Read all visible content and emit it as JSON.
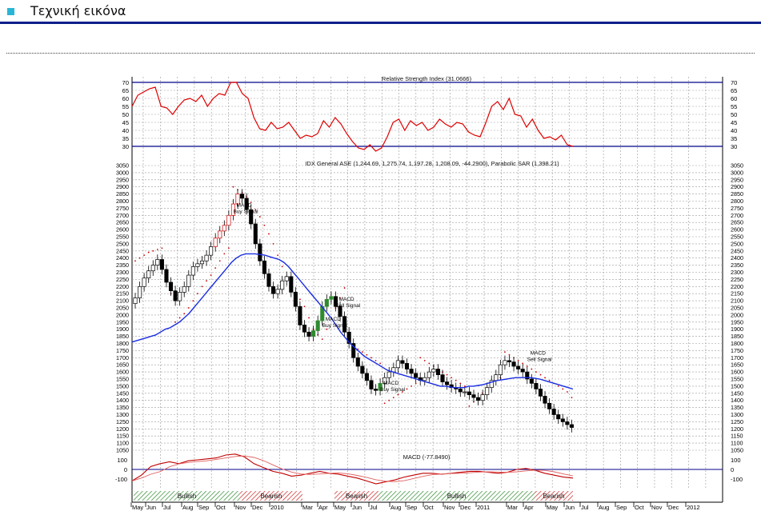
{
  "header": {
    "title": "Τεχνική εικόνα"
  },
  "chart_data": {
    "type": "candlestick",
    "price_title": "IDX General ASE (1,244.69, 1,275.74, 1,197.28, 1,208.09, -44.2900), Parabolic SAR (1,398.21)",
    "price_ylim": [
      1050,
      3050
    ],
    "price_ticks": [
      1050,
      1100,
      1150,
      1200,
      1250,
      1300,
      1350,
      1400,
      1450,
      1500,
      1550,
      1600,
      1650,
      1700,
      1750,
      1800,
      1850,
      1900,
      1950,
      2000,
      2050,
      2100,
      2150,
      2200,
      2250,
      2300,
      2350,
      2400,
      2450,
      2500,
      2550,
      2600,
      2650,
      2700,
      2750,
      2800,
      2850,
      2900,
      2950,
      3000,
      3050
    ],
    "price_close": [
      2120,
      2200,
      2260,
      2310,
      2350,
      2390,
      2320,
      2230,
      2170,
      2100,
      2160,
      2200,
      2280,
      2340,
      2360,
      2380,
      2420,
      2480,
      2540,
      2590,
      2630,
      2700,
      2780,
      2850,
      2820,
      2740,
      2640,
      2500,
      2380,
      2290,
      2200,
      2150,
      2180,
      2240,
      2270,
      2160,
      2060,
      1930,
      1880,
      1850,
      1890,
      1960,
      2060,
      2110,
      2130,
      2060,
      1990,
      1880,
      1800,
      1700,
      1640,
      1590,
      1540,
      1480,
      1470,
      1520,
      1560,
      1600,
      1630,
      1680,
      1660,
      1620,
      1590,
      1560,
      1540,
      1560,
      1600,
      1620,
      1580,
      1530,
      1510,
      1490,
      1480,
      1460,
      1460,
      1440,
      1420,
      1400,
      1440,
      1490,
      1540,
      1580,
      1650,
      1680,
      1670,
      1640,
      1620,
      1600,
      1550,
      1520,
      1480,
      1430,
      1380,
      1340,
      1300,
      1270,
      1250,
      1230,
      1210
    ],
    "sar": [
      2380,
      2400,
      2420,
      2440,
      2450,
      2460,
      2470,
      2250,
      2150,
      1950,
      1980,
      2010,
      2050,
      2100,
      2150,
      2200,
      2240,
      2280,
      2330,
      2380,
      2430,
      2470,
      2900,
      2880,
      2860,
      2830,
      2790,
      2740,
      2690,
      2630,
      2570,
      2500,
      2420,
      2340,
      2270,
      2210,
      2160,
      2110,
      2060,
      1980,
      1900,
      1860,
      1830,
      1900,
      1980,
      2050,
      2120,
      2190,
      1800,
      1780,
      1760,
      1740,
      1720,
      1700,
      1680,
      1660,
      1380,
      1400,
      1420,
      1440,
      1460,
      1480,
      1500,
      1520,
      1700,
      1680,
      1660,
      1640,
      1620,
      1600,
      1580,
      1560,
      1540,
      1520,
      1500,
      1360,
      1390,
      1420,
      1450,
      1480,
      1510,
      1540,
      1560,
      1740,
      1720,
      1700,
      1680,
      1660,
      1640,
      1620,
      1600,
      1580,
      1560,
      1540,
      1520,
      1500,
      1480,
      1460,
      1420
    ],
    "ma": [
      1810,
      1820,
      1830,
      1840,
      1850,
      1860,
      1880,
      1900,
      1910,
      1930,
      1950,
      1980,
      2010,
      2050,
      2090,
      2130,
      2170,
      2210,
      2250,
      2290,
      2330,
      2370,
      2400,
      2420,
      2430,
      2430,
      2430,
      2425,
      2420,
      2410,
      2400,
      2390,
      2370,
      2340,
      2300,
      2260,
      2220,
      2180,
      2140,
      2100,
      2060,
      2020,
      1980,
      1930,
      1880,
      1840,
      1800,
      1770,
      1740,
      1710,
      1690,
      1670,
      1650,
      1630,
      1610,
      1600,
      1590,
      1580,
      1570,
      1560,
      1550,
      1540,
      1530,
      1520,
      1510,
      1500,
      1500,
      1495,
      1490,
      1490,
      1490,
      1500,
      1500,
      1505,
      1510,
      1520,
      1530,
      1540,
      1545,
      1550,
      1555,
      1560,
      1560,
      1560,
      1560,
      1555,
      1550,
      1540,
      1530,
      1520,
      1510,
      1500,
      1490,
      1480
    ],
    "rsi_title": "Relative Strength Index (31.0666)",
    "rsi_ticks": [
      30,
      35,
      40,
      45,
      50,
      55,
      60,
      65,
      70
    ],
    "rsi": [
      55,
      62,
      64,
      66,
      67,
      55,
      54,
      50,
      55,
      59,
      60,
      58,
      62,
      55,
      60,
      63,
      62,
      70,
      70,
      63,
      60,
      48,
      41,
      40,
      45,
      41,
      42,
      45,
      40,
      35,
      37,
      36,
      38,
      46,
      42,
      48,
      44,
      38,
      33,
      29,
      28,
      31,
      27,
      29,
      36,
      45,
      47,
      40,
      46,
      43,
      45,
      40,
      42,
      47,
      44,
      42,
      45,
      44,
      39,
      37,
      36,
      45,
      55,
      58,
      53,
      60,
      50,
      49,
      42,
      47,
      40,
      35,
      36,
      34,
      37,
      31,
      30
    ],
    "macd_title": "MACD (-77.8490)",
    "macd_ticks": [
      100,
      0,
      -100
    ],
    "macd": [
      -120,
      -60,
      30,
      60,
      80,
      60,
      90,
      100,
      110,
      120,
      150,
      160,
      130,
      60,
      20,
      -20,
      -40,
      -70,
      -60,
      -40,
      -20,
      -40,
      -50,
      -70,
      -90,
      -120,
      -150,
      -130,
      -110,
      -80,
      -60,
      -40,
      -40,
      -50,
      -40,
      -30,
      -20,
      -20,
      -30,
      -40,
      -30,
      0,
      10,
      -10,
      -40,
      -60,
      -80,
      -90
    ],
    "annotations": [
      {
        "text": "MACD",
        "sub": "Buy Signal"
      },
      {
        "text": "MACD",
        "sub": "Sell Signal"
      },
      {
        "text": "MACD",
        "sub": "Buy Signal"
      },
      {
        "text": "MACD",
        "sub": "Buy Signal"
      },
      {
        "text": "MACD",
        "sub": "Sell Signal"
      }
    ],
    "trend_bands": [
      {
        "label": "Bullish"
      },
      {
        "label": "Bearish"
      },
      {
        "label": "Bearish"
      },
      {
        "label": "Bullish"
      },
      {
        "label": "Bearish"
      }
    ],
    "x_labels": [
      "May",
      "Jun",
      "Jul",
      "Aug",
      "Sep",
      "Oct",
      "Nov",
      "Dec",
      "2010",
      "Mar",
      "Apr",
      "May",
      "Jun",
      "Jul",
      "Aug",
      "Sep",
      "Oct",
      "Nov",
      "Dec",
      "2011",
      "Mar",
      "Apr",
      "May",
      "Jun",
      "Jul",
      "Aug",
      "Sep",
      "Oct",
      "Nov",
      "Dec",
      "2012"
    ],
    "colors": {
      "price_up": "#cc0000",
      "price_up_green": "#2e8b2e",
      "price_down": "#000000",
      "ma": "#1a2de0",
      "rsi": "#e00000",
      "sar": "#cc0000",
      "band_bull": "#2e8b2e",
      "band_bear": "#cc2222",
      "ref_line": "#00008b"
    }
  }
}
